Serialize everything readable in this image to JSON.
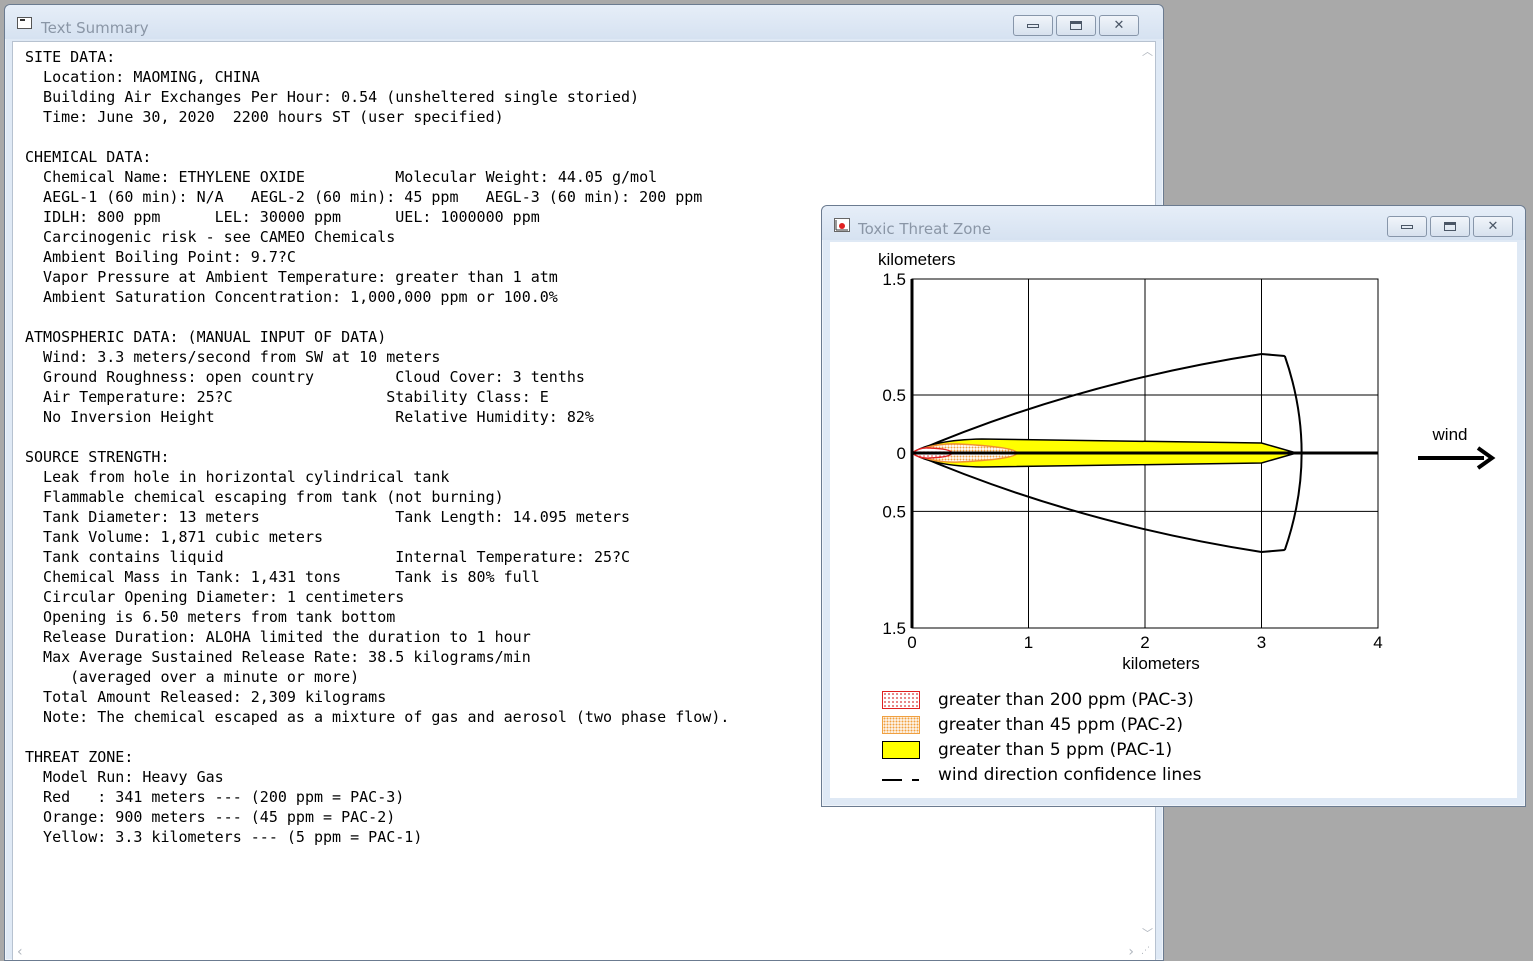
{
  "summary_window": {
    "title": "Text Summary",
    "lines": [
      "SITE DATA:",
      "  Location: MAOMING, CHINA",
      "  Building Air Exchanges Per Hour: 0.54 (unsheltered single storied)",
      "  Time: June 30, 2020  2200 hours ST (user specified)",
      "",
      "CHEMICAL DATA:",
      "  Chemical Name: ETHYLENE OXIDE          Molecular Weight: 44.05 g/mol",
      "  AEGL-1 (60 min): N/A   AEGL-2 (60 min): 45 ppm   AEGL-3 (60 min): 200 ppm",
      "  IDLH: 800 ppm      LEL: 30000 ppm      UEL: 1000000 ppm",
      "  Carcinogenic risk - see CAMEO Chemicals",
      "  Ambient Boiling Point: 9.7?C",
      "  Vapor Pressure at Ambient Temperature: greater than 1 atm",
      "  Ambient Saturation Concentration: 1,000,000 ppm or 100.0%",
      "",
      "ATMOSPHERIC DATA: (MANUAL INPUT OF DATA)",
      "  Wind: 3.3 meters/second from SW at 10 meters",
      "  Ground Roughness: open country         Cloud Cover: 3 tenths",
      "  Air Temperature: 25?C                 Stability Class: E",
      "  No Inversion Height                    Relative Humidity: 82%",
      "",
      "SOURCE STRENGTH:",
      "  Leak from hole in horizontal cylindrical tank",
      "  Flammable chemical escaping from tank (not burning)",
      "  Tank Diameter: 13 meters               Tank Length: 14.095 meters",
      "  Tank Volume: 1,871 cubic meters",
      "  Tank contains liquid                   Internal Temperature: 25?C",
      "  Chemical Mass in Tank: 1,431 tons      Tank is 80% full",
      "  Circular Opening Diameter: 1 centimeters",
      "  Opening is 6.50 meters from tank bottom",
      "  Release Duration: ALOHA limited the duration to 1 hour",
      "  Max Average Sustained Release Rate: 38.5 kilograms/min",
      "     (averaged over a minute or more)",
      "  Total Amount Released: 2,309 kilograms",
      "  Note: The chemical escaped as a mixture of gas and aerosol (two phase flow).",
      "",
      "THREAT ZONE:",
      "  Model Run: Heavy Gas",
      "  Red   : 341 meters --- (200 ppm = PAC-3)",
      "  Orange: 900 meters --- (45 ppm = PAC-2)",
      "  Yellow: 3.3 kilometers --- (5 ppm = PAC-1)"
    ]
  },
  "threat_window": {
    "title": "Toxic Threat Zone",
    "y_axis_label": "kilometers",
    "x_axis_label": "kilometers",
    "y_tick_labels": [
      "1.5",
      "0.5",
      "0",
      "0.5",
      "1.5"
    ],
    "x_tick_labels": [
      "0",
      "1",
      "2",
      "3",
      "4"
    ],
    "wind_label": "wind",
    "legend": [
      {
        "label": "greater than 200 ppm (PAC-3)",
        "color": "#e02020"
      },
      {
        "label": "greater than 45 ppm (PAC-2)",
        "color": "#f0a040"
      },
      {
        "label": "greater than 5 ppm (PAC-1)",
        "color": "#ffff00"
      },
      {
        "label": "wind direction confidence lines",
        "color": "#000000"
      }
    ],
    "zones": {
      "red_km": 0.341,
      "orange_km": 0.9,
      "yellow_km": 3.3
    }
  }
}
